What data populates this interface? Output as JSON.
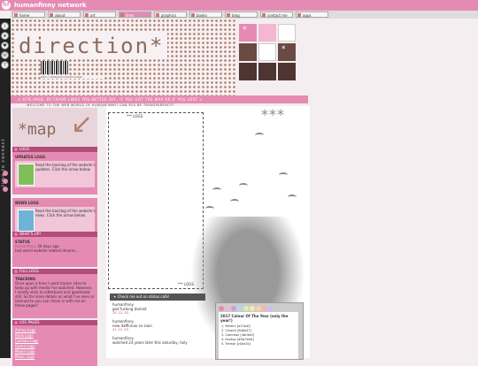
{
  "site": {
    "title": "humanfinny network",
    "logo_text": "hf"
  },
  "tabs": [
    {
      "label": "home",
      "active": false
    },
    {
      "label": "about",
      "active": false
    },
    {
      "label": "art",
      "active": false
    },
    {
      "label": "links",
      "active": true
    },
    {
      "label": "graphics",
      "active": false
    },
    {
      "label": "books",
      "active": false
    },
    {
      "label": "blog",
      "active": false
    },
    {
      "label": "contact me",
      "active": false
    },
    {
      "label": "apps",
      "active": false
    }
  ],
  "sidebar": {
    "icons": [
      "info-icon",
      "star-icon",
      "heart-icon",
      "mail-icon",
      "question-icon"
    ],
    "icon_glyphs": [
      "i",
      "★",
      "♥",
      "✉",
      "?"
    ],
    "vertical_text": "time to connect"
  },
  "header": {
    "hero": "direction",
    "hero_star": "*",
    "barcode_label": "000 // /ref/web/humanfinny/splr",
    "welcome": "WELCOME TO THE WEB WORLD OF HUMANFINNY! CAN YOU BE TRANSPARENCY?"
  },
  "grid_squares": [
    {
      "color": "#e58bb3",
      "glyph": "*"
    },
    {
      "color": "#f6b6d0",
      "glyph": ""
    },
    {
      "color": "#ffffff",
      "glyph": ""
    },
    {
      "color": "#6b4a44",
      "glyph": ""
    },
    {
      "color": "#ffffff",
      "glyph": ""
    },
    {
      "color": "#6b4a44",
      "glyph": "*"
    },
    {
      "color": "#4f3532",
      "glyph": ""
    },
    {
      "color": "#4f3532",
      "glyph": ""
    },
    {
      "color": "#4f3532",
      "glyph": ""
    }
  ],
  "marquee": "< SITE PAGE: BY FAVOR LINKS YOU BETTER OFF, IF YOU GOT THE MAP OR IF YOU LOST >",
  "map": {
    "label": "*map"
  },
  "panels": {
    "logs": {
      "title": "LOGS"
    },
    "updates": {
      "title": "UPDATES LOGS",
      "text": "Read the backlog of the website's updates. Click the arrow below."
    },
    "news": {
      "title": "NEWS LOGS",
      "text": "Read the backlog of the website's news. Click the arrow below."
    },
    "whats_up": {
      "title": "WHAT'S UP?"
    },
    "status_label": "STATUS",
    "status_user": "humanfinny",
    "status_time": "30 days ago",
    "status_text": "had weird website related dreams...",
    "full_logs": {
      "title": "FULL LOGS"
    },
    "tracking_label": "TRACKING",
    "tracking_text": "Once upon a time I used tracker sites to keep up with media I've watched. However, I mostly stick to letterboxd and goodreads still. So for more details on what I've seen or listened to you can check in with me on these pages!",
    "log_pages": {
      "title": "LOG PAGES",
      "items": [
        "Anime Logs",
        "Book Logs",
        "Cartoon Logs",
        "Game Logs",
        "Movie Logs",
        "Music Logs"
      ]
    }
  },
  "content": {
    "frame_label": "*** LOGS",
    "frame_footer": "*** LOGS",
    "stars": "***"
  },
  "status_feed": {
    "header": "✦ Check me out on status.cafe!",
    "items": [
      {
        "user": "humanfinny",
        "text": "god fucking damnit",
        "time": "25. 12. 03"
      },
      {
        "user": "humanfinny",
        "text": "new daffinnax so soon",
        "time": "21. 12. 03"
      },
      {
        "user": "humanfinny",
        "text": "watched 24 years later this saturday, holy",
        "time": ""
      }
    ]
  },
  "calendar": {
    "circle_colors": [
      "#e58bb3",
      "#f6b6d0",
      "#c9a0dc",
      "#b3d9e8",
      "#d8f0b0",
      "#ffeaa0",
      "#ffd0a0",
      "#ffb0b0",
      "#c0c0ff"
    ],
    "title": "2017 Colour Of The Year (only the year!)",
    "rows": [
      "1. Martini [d13a4f]",
      "2. Chianti [9b8a47]",
      "3. Common [4bc9a0]",
      "4. Ksetup [#0b7b9d]",
      "5. Tremor [c0aa3c]"
    ]
  }
}
